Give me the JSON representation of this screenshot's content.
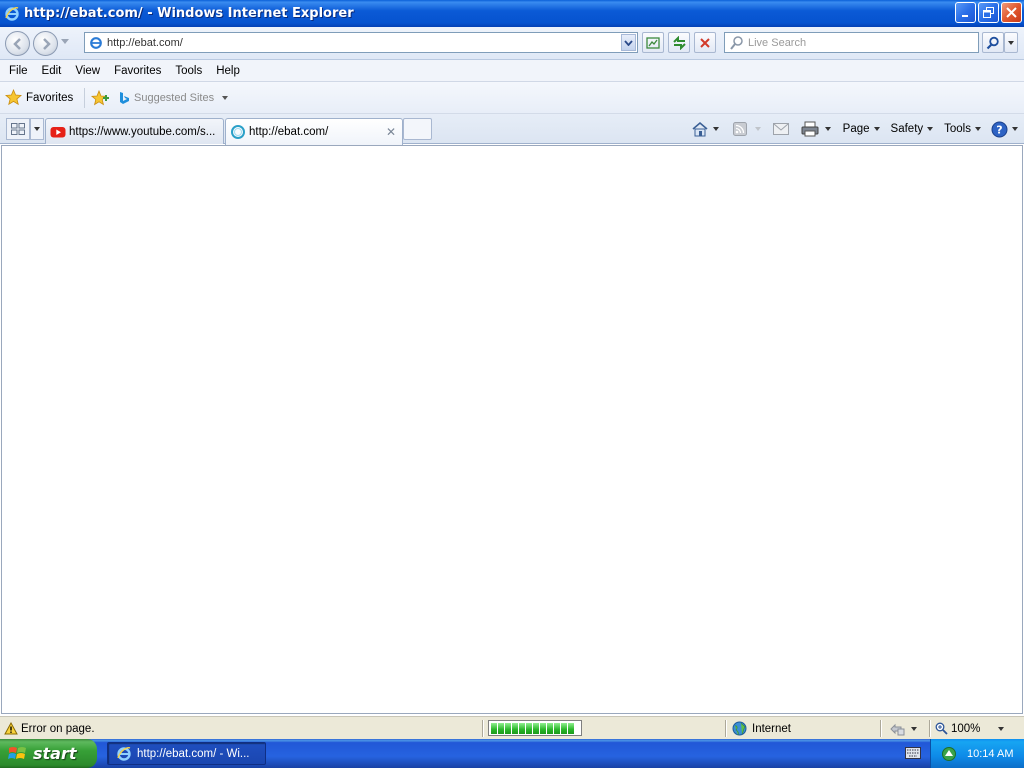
{
  "window": {
    "title": "http://ebat.com/ - Windows Internet Explorer"
  },
  "address": {
    "url": "http://ebat.com/"
  },
  "search": {
    "placeholder": "Live Search"
  },
  "menu": {
    "items": [
      "File",
      "Edit",
      "View",
      "Favorites",
      "Tools",
      "Help"
    ]
  },
  "favorites_bar": {
    "favorites_label": "Favorites",
    "suggested_sites_label": "Suggested Sites"
  },
  "tabs": [
    {
      "label": "https://www.youtube.com/s...",
      "active": false
    },
    {
      "label": "http://ebat.com/",
      "active": true
    }
  ],
  "command_bar": {
    "page_label": "Page",
    "safety_label": "Safety",
    "tools_label": "Tools"
  },
  "status_bar": {
    "message": "Error on page.",
    "zone": "Internet",
    "zoom": "100%",
    "progress_segments": 12
  },
  "taskbar": {
    "start_label": "start",
    "task_item": "http://ebat.com/ - Wi...",
    "clock": "10:14 AM"
  },
  "colors": {
    "titlebar": "#0b5ad6",
    "taskbar": "#2663e0",
    "start_button": "#37a037",
    "tray": "#0e8ae8"
  }
}
